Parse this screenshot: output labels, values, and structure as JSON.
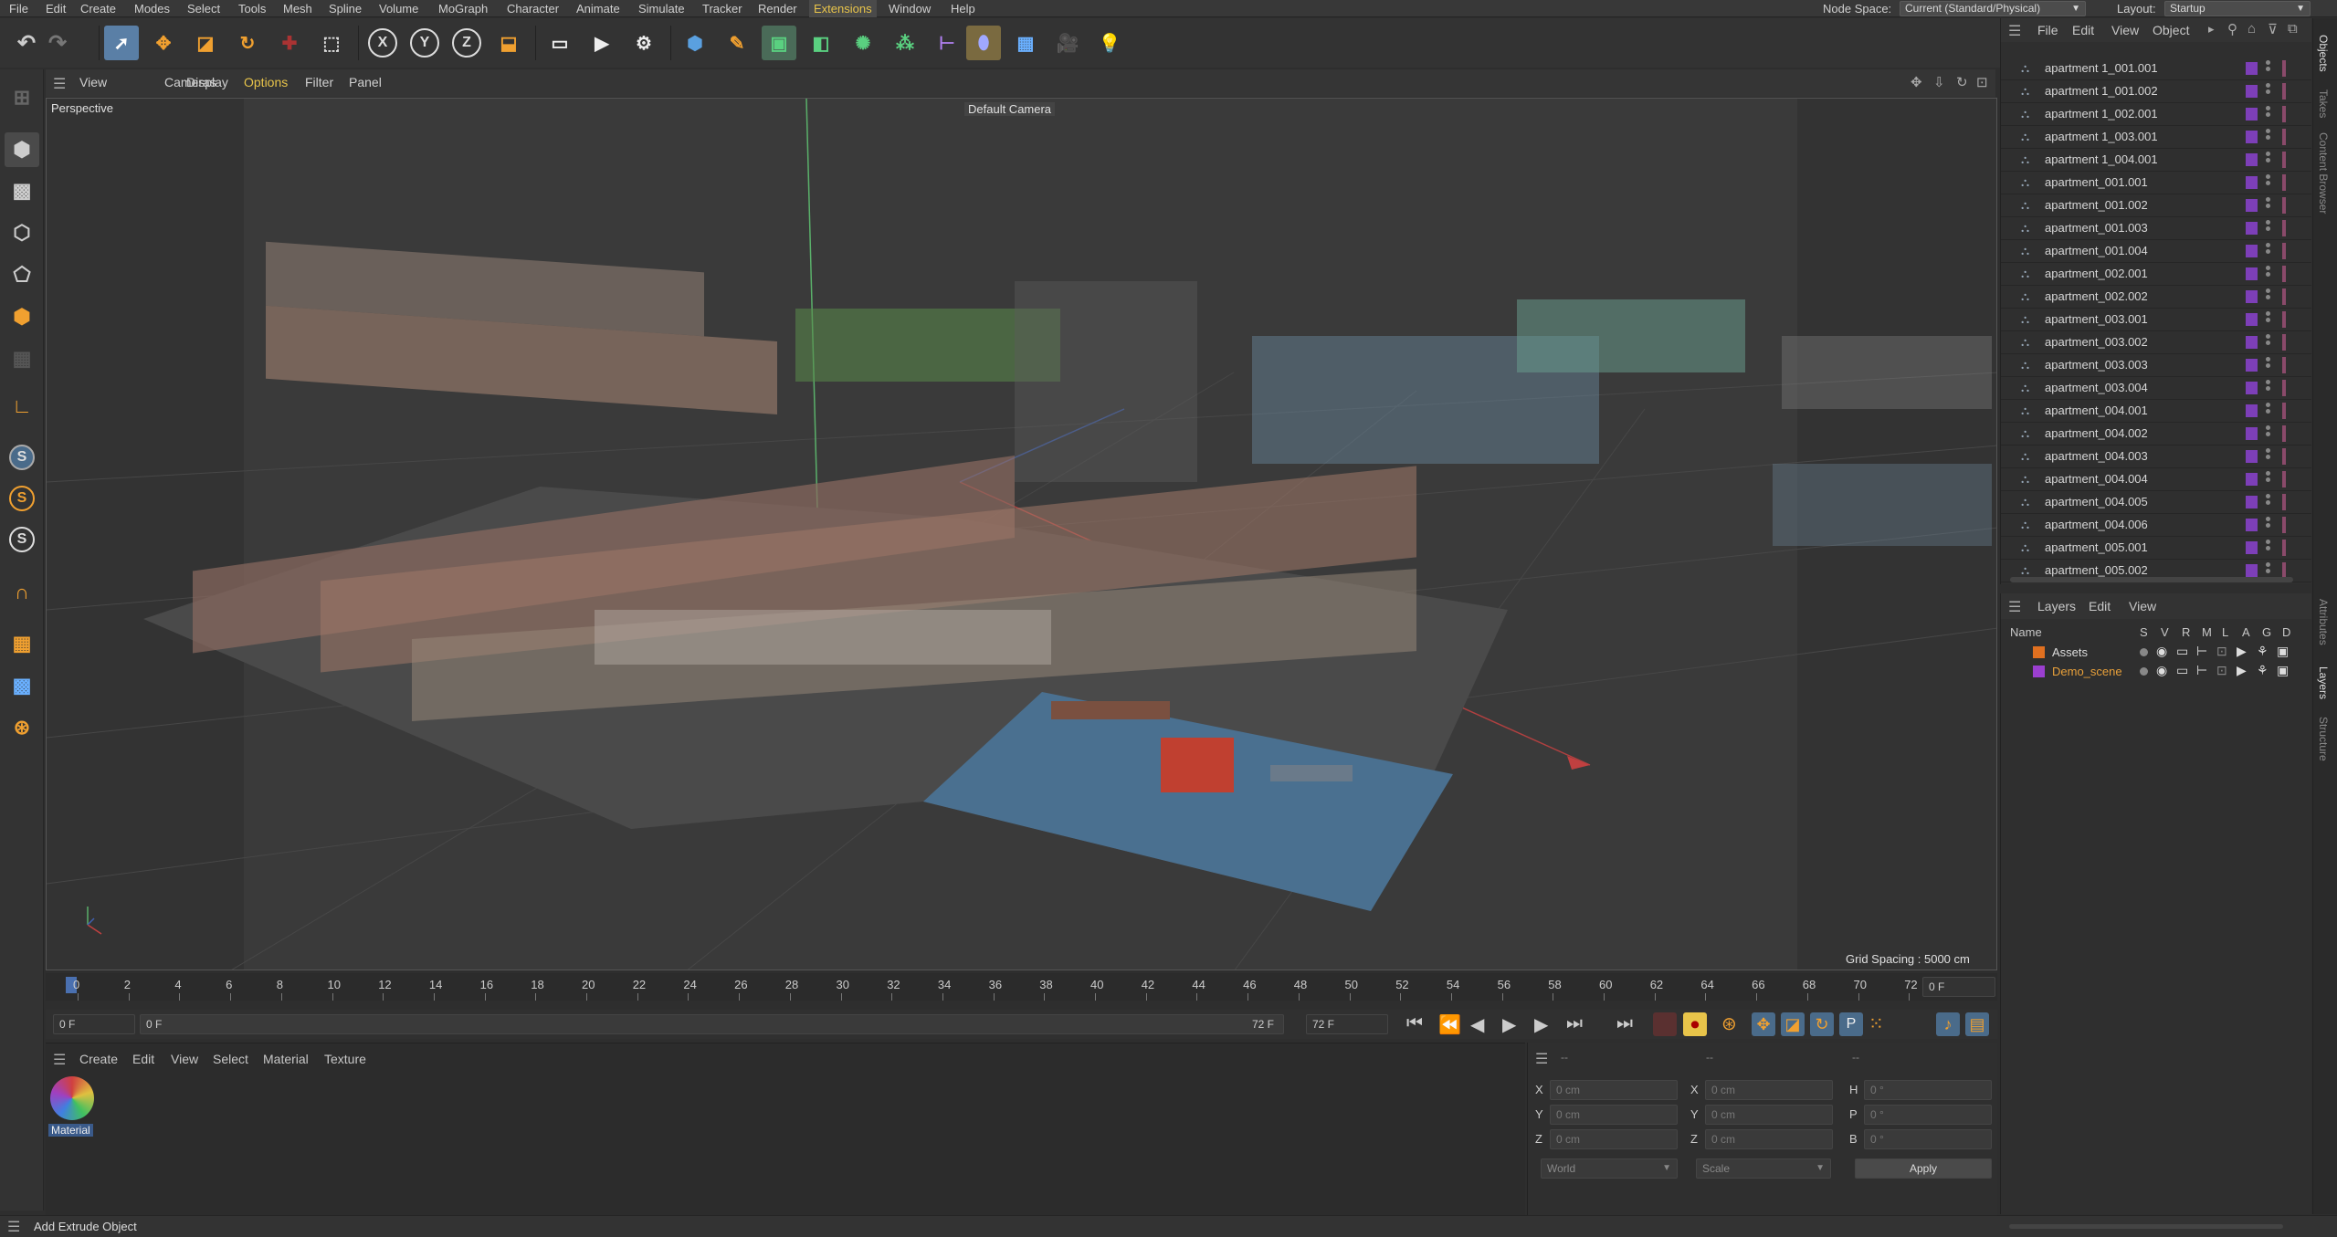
{
  "menubar": {
    "items": [
      "File",
      "Edit",
      "Create",
      "Modes",
      "Select",
      "Tools",
      "Mesh",
      "Spline",
      "Volume",
      "MoGraph",
      "Character",
      "Animate",
      "Simulate",
      "Tracker",
      "Render",
      "Extensions",
      "Window",
      "Help"
    ],
    "active": "Extensions",
    "node_space_label": "Node Space:",
    "node_space_value": "Current (Standard/Physical)",
    "layout_label": "Layout:",
    "layout_value": "Startup"
  },
  "viewport": {
    "menu": [
      "View",
      "Cameras",
      "Display",
      "Options",
      "Filter",
      "Panel"
    ],
    "active_menu": "Options",
    "label": "Perspective",
    "camera": "Default Camera",
    "grid_spacing": "Grid Spacing : 5000 cm"
  },
  "timeline": {
    "ticks": [
      "0",
      "2",
      "4",
      "6",
      "8",
      "10",
      "12",
      "14",
      "16",
      "18",
      "20",
      "22",
      "24",
      "26",
      "28",
      "30",
      "32",
      "34",
      "36",
      "38",
      "40",
      "42",
      "44",
      "46",
      "48",
      "50",
      "52",
      "54",
      "56",
      "58",
      "60",
      "62",
      "64",
      "66",
      "68",
      "70",
      "72"
    ],
    "current_frame": "0 F",
    "start": "0 F",
    "range_start": "0 F",
    "range_end": "72 F",
    "end": "72 F"
  },
  "material_manager": {
    "menu": [
      "Create",
      "Edit",
      "View",
      "Select",
      "Material",
      "Texture"
    ],
    "material_name": "Material"
  },
  "attributes": {
    "header": [
      "--",
      "--",
      "--"
    ],
    "rows": [
      {
        "a": "X",
        "av": "0 cm",
        "b": "X",
        "bv": "0 cm",
        "c": "H",
        "cv": "0 °"
      },
      {
        "a": "Y",
        "av": "0 cm",
        "b": "Y",
        "bv": "0 cm",
        "c": "P",
        "cv": "0 °"
      },
      {
        "a": "Z",
        "av": "0 cm",
        "b": "Z",
        "bv": "0 cm",
        "c": "B",
        "cv": "0 °"
      }
    ],
    "coord_mode": "World",
    "scale_mode": "Scale",
    "apply": "Apply"
  },
  "object_manager": {
    "menu": [
      "File",
      "Edit",
      "View",
      "Object"
    ],
    "objects": [
      "apartment 1_001.001",
      "apartment 1_001.002",
      "apartment 1_002.001",
      "apartment 1_003.001",
      "apartment 1_004.001",
      "apartment_001.001",
      "apartment_001.002",
      "apartment_001.003",
      "apartment_001.004",
      "apartment_002.001",
      "apartment_002.002",
      "apartment_003.001",
      "apartment_003.002",
      "apartment_003.003",
      "apartment_003.004",
      "apartment_004.001",
      "apartment_004.002",
      "apartment_004.003",
      "apartment_004.004",
      "apartment_004.005",
      "apartment_004.006",
      "apartment_005.001",
      "apartment_005.002"
    ]
  },
  "layer_manager": {
    "menu": [
      "Layers",
      "Edit",
      "View"
    ],
    "columns": [
      "Name",
      "S",
      "V",
      "R",
      "M",
      "L",
      "A",
      "G",
      "D"
    ],
    "layers": [
      {
        "name": "Assets",
        "color": "#e07020"
      },
      {
        "name": "Demo_scene",
        "color": "#9b3fd0"
      }
    ]
  },
  "side_tabs": [
    "Objects",
    "Takes",
    "Content Browser",
    "Attributes",
    "Layers",
    "Structure"
  ],
  "status": "Add Extrude Object",
  "colors": {
    "accent": "#e8c44a",
    "selection": "#5a7fa6",
    "layer_purple": "#7d3fb8"
  }
}
